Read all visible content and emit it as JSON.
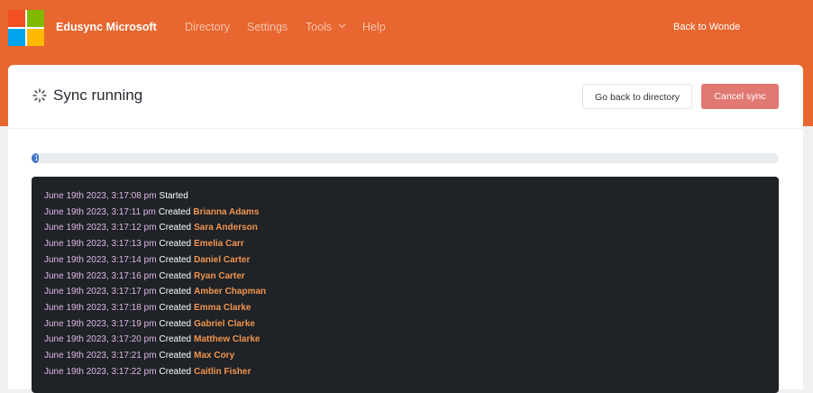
{
  "header": {
    "brand": "Edusync Microsoft",
    "logo_colors": [
      "#f25022",
      "#7fba00",
      "#00a4ef",
      "#ffb900"
    ],
    "nav": [
      {
        "label": "Directory"
      },
      {
        "label": "Settings"
      },
      {
        "label": "Tools"
      },
      {
        "label": "Help"
      }
    ],
    "back_link": "Back to Wonde"
  },
  "sync": {
    "title": "Sync running",
    "go_back_label": "Go back to directory",
    "cancel_label": "Cancel sync",
    "progress_percent": 1,
    "progress_label": "1"
  },
  "log": [
    {
      "timestamp": "June 19th 2023, 3:17:08 pm",
      "action": "Started",
      "name": ""
    },
    {
      "timestamp": "June 19th 2023, 3:17:11 pm",
      "action": "Created",
      "name": "Brianna Adams"
    },
    {
      "timestamp": "June 19th 2023, 3:17:12 pm",
      "action": "Created",
      "name": "Sara Anderson"
    },
    {
      "timestamp": "June 19th 2023, 3:17:13 pm",
      "action": "Created",
      "name": "Emelia Carr"
    },
    {
      "timestamp": "June 19th 2023, 3:17:14 pm",
      "action": "Created",
      "name": "Daniel Carter"
    },
    {
      "timestamp": "June 19th 2023, 3:17:16 pm",
      "action": "Created",
      "name": "Ryan Carter"
    },
    {
      "timestamp": "June 19th 2023, 3:17:17 pm",
      "action": "Created",
      "name": "Amber Chapman"
    },
    {
      "timestamp": "June 19th 2023, 3:17:18 pm",
      "action": "Created",
      "name": "Emma Clarke"
    },
    {
      "timestamp": "June 19th 2023, 3:17:19 pm",
      "action": "Created",
      "name": "Gabriel Clarke"
    },
    {
      "timestamp": "June 19th 2023, 3:17:20 pm",
      "action": "Created",
      "name": "Matthew Clarke"
    },
    {
      "timestamp": "June 19th 2023, 3:17:21 pm",
      "action": "Created",
      "name": "Max Cory"
    },
    {
      "timestamp": "June 19th 2023, 3:17:22 pm",
      "action": "Created",
      "name": "Caitlin Fisher"
    }
  ]
}
